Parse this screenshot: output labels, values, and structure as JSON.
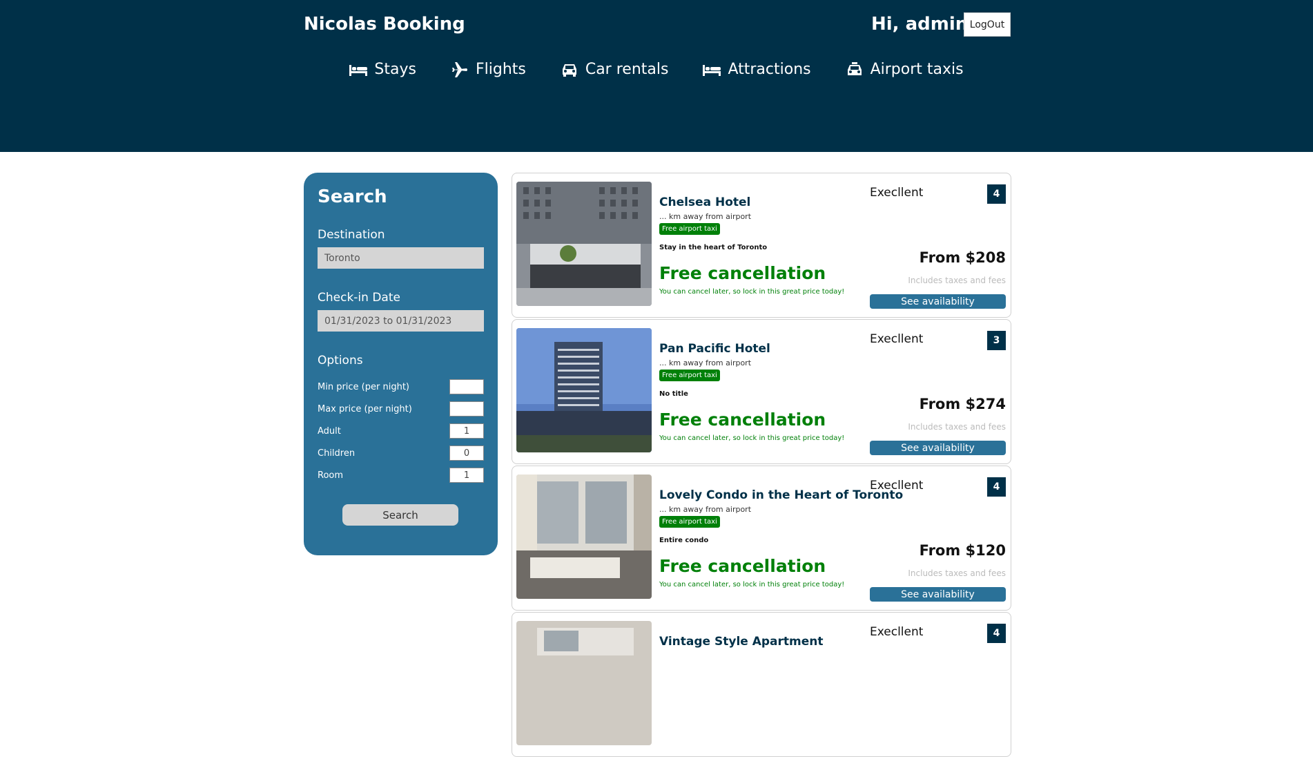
{
  "header": {
    "brand": "Nicolas Booking",
    "greeting": "Hi, admin",
    "logout_label": "LogOut",
    "nav": [
      {
        "label": "Stays",
        "icon": "bed-icon"
      },
      {
        "label": "Flights",
        "icon": "plane-icon"
      },
      {
        "label": "Car rentals",
        "icon": "car-icon"
      },
      {
        "label": "Attractions",
        "icon": "bed-icon"
      },
      {
        "label": "Airport taxis",
        "icon": "taxi-icon"
      }
    ]
  },
  "search": {
    "title": "Search",
    "destination_label": "Destination",
    "destination_value": "Toronto",
    "date_label": "Check-in Date",
    "date_value": "01/31/2023 to 01/31/2023",
    "options_label": "Options",
    "options": [
      {
        "label": "Min price (per night)",
        "value": ""
      },
      {
        "label": "Max price (per night)",
        "value": ""
      },
      {
        "label": "Adult",
        "value": "1"
      },
      {
        "label": "Children",
        "value": "0"
      },
      {
        "label": "Room",
        "value": "1"
      }
    ],
    "button_label": "Search"
  },
  "results": [
    {
      "name": "Chelsea Hotel",
      "distance": "... km away from airport",
      "taxi": "Free airport taxi",
      "subtitle": "Stay in the heart of Toronto",
      "cancel": "Free cancellation",
      "cancel_sub": "You can cancel later, so lock in this great price today!",
      "rating_text": "Execllent",
      "score": "4",
      "price": "From $208",
      "tax": "Includes taxes and fees",
      "avail": "See availability"
    },
    {
      "name": "Pan Pacific Hotel",
      "distance": "... km away from airport",
      "taxi": "Free airport taxi",
      "subtitle": "No title",
      "cancel": "Free cancellation",
      "cancel_sub": "You can cancel later, so lock in this great price today!",
      "rating_text": "Execllent",
      "score": "3",
      "price": "From $274",
      "tax": "Includes taxes and fees",
      "avail": "See availability"
    },
    {
      "name": "Lovely Condo in the Heart of Toronto",
      "distance": "... km away from airport",
      "taxi": "Free airport taxi",
      "subtitle": "Entire condo",
      "cancel": "Free cancellation",
      "cancel_sub": "You can cancel later, so lock in this great price today!",
      "rating_text": "Execllent",
      "score": "4",
      "price": "From $120",
      "tax": "Includes taxes and fees",
      "avail": "See availability"
    },
    {
      "name": "Vintage Style Apartment",
      "distance": "",
      "taxi": "",
      "subtitle": "",
      "cancel": "",
      "cancel_sub": "",
      "rating_text": "Execllent",
      "score": "4",
      "price": "",
      "tax": "",
      "avail": ""
    }
  ]
}
